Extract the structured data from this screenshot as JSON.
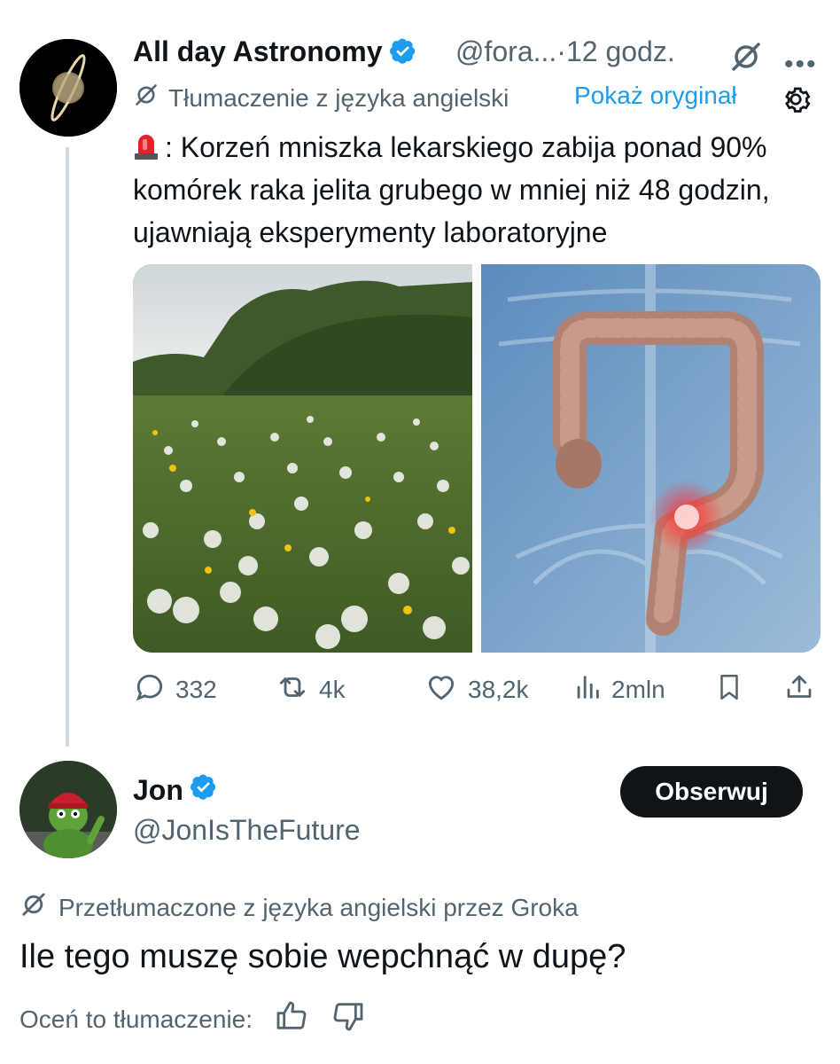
{
  "tweet": {
    "author_name": "All day Astronomy",
    "handle": "@fora...",
    "separator": "·",
    "time": "12 godz.",
    "more_icon": "more-icon",
    "translation_label": "Tłumaczenie z języka angielski",
    "show_original": "Pokaż oryginał",
    "text_prefix_emoji": "siren-emoji",
    "text": ": Korzeń mniszka lekarskiego zabija ponad 90% komórek raka jelita grubego w mniej niż 48 godzin, ujawniają eksperymenty laboratoryjne",
    "media": [
      "dandelion-field-photo",
      "colon-illustration"
    ],
    "stats": {
      "replies": "332",
      "reposts": "4k",
      "likes": "38,2k",
      "views": "2mln"
    }
  },
  "reply": {
    "author_name": "Jon",
    "handle": "@JonIsTheFuture",
    "follow_label": "Obserwuj",
    "translation_label": "Przetłumaczone z języka angielski przez Groka",
    "text": "Ile tego muszę sobie wepchnąć w dupę?",
    "rate_label": "Oceń to tłumaczenie:"
  },
  "colors": {
    "accent": "#1d9bf0",
    "secondary_text": "#536471",
    "thread_line": "#cfd9de",
    "button_bg": "#0f1419"
  }
}
